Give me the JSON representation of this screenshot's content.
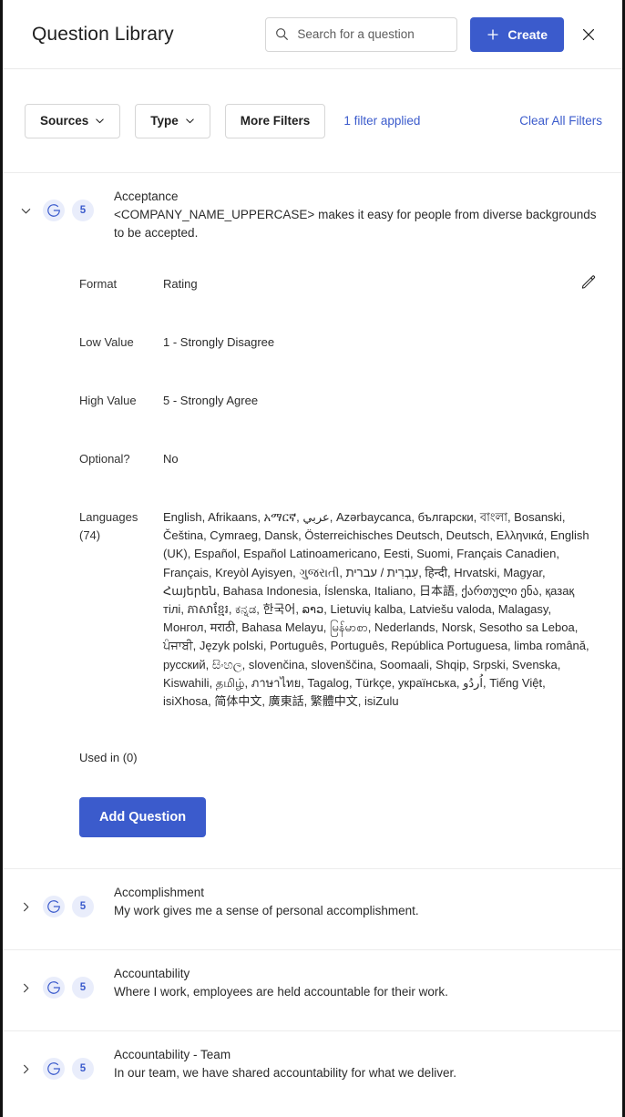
{
  "header": {
    "title": "Question Library",
    "search": {
      "placeholder": "Search for a question",
      "value": "",
      "icon": "search-icon"
    },
    "create_button": {
      "label": "Create",
      "icon": "plus-icon"
    },
    "close_icon": "close-icon",
    "accent_color": "#3b5bcc"
  },
  "filters": {
    "sources_label": "Sources",
    "type_label": "Type",
    "more_filters_label": "More Filters",
    "filter_applied_label": "1 filter applied",
    "clear_all_label": "Clear All Filters",
    "link_color": "#3b5bcc"
  },
  "questions": [
    {
      "expanded": true,
      "chevron": "chevron-down-icon",
      "source_icon": "g-logo-icon",
      "scale_badge": "5",
      "category": "Acceptance",
      "text": "<COMPANY_NAME_UPPERCASE> makes it easy for people from diverse backgrounds to be accepted.",
      "details": [
        {
          "label": "Format",
          "value": "Rating"
        },
        {
          "label": "Low Value",
          "value": "1 - Strongly Disagree"
        },
        {
          "label": "High Value",
          "value": "5 - Strongly Agree"
        },
        {
          "label": "Optional?",
          "value": "No"
        }
      ],
      "languages_label": "Languages",
      "languages_count": "(74)",
      "languages_value": "English, Afrikaans, አማርኛ, عربي, Azərbaycanca, български, বাংলা, Bosanski, Čeština, Cymraeg, Dansk, Österreichisches Deutsch, Deutsch, Ελληνικά, English (UK), Español, Español Latinoamericano, Eesti, Suomi, Français Canadien, Français, Kreyòl Ayisyen, ગુજરાતી, עִבְרִית / עברית, हिन्दी, Hrvatski, Magyar, Հայերեն, Bahasa Indonesia, Íslenska, Italiano, 日本語, ქართული ენა, қазақ тілі, ភាសាខ្មែរ, ಕನ್ನಡ, 한국어, ລາວ, Lietuvių kalba, Latviešu valoda, Malagasy, Монгол, मराठी, Bahasa Melayu, မြန်မာစာ, Nederlands, Norsk, Sesotho sa Leboa, ਪੰਜਾਬੀ, Język polski, Português, Português, República Portuguesa, limba română, русский, සිංහල, slovenčina, slovenščina, Soomaali, Shqip, Srpski, Svenska, Kiswahili, தமிழ், ภาษาไทย, Tagalog, Türkçe, українська, اُردُو, Tiếng Việt, isiXhosa, 简体中文, 廣東話, 繁體中文, isiZulu",
      "used_in_label": "Used in (0)",
      "add_question_label": "Add Question",
      "edit_icon": "edit-pencil-icon"
    },
    {
      "expanded": false,
      "chevron": "chevron-right-icon",
      "source_icon": "g-logo-icon",
      "scale_badge": "5",
      "category": "Accomplishment",
      "text": "My work gives me a sense of personal accomplishment."
    },
    {
      "expanded": false,
      "chevron": "chevron-right-icon",
      "source_icon": "g-logo-icon",
      "scale_badge": "5",
      "category": "Accountability",
      "text": "Where I work, employees are held accountable for their work."
    },
    {
      "expanded": false,
      "chevron": "chevron-right-icon",
      "source_icon": "g-logo-icon",
      "scale_badge": "5",
      "category": "Accountability - Team",
      "text": "In our team, we have shared accountability for what we deliver."
    }
  ]
}
